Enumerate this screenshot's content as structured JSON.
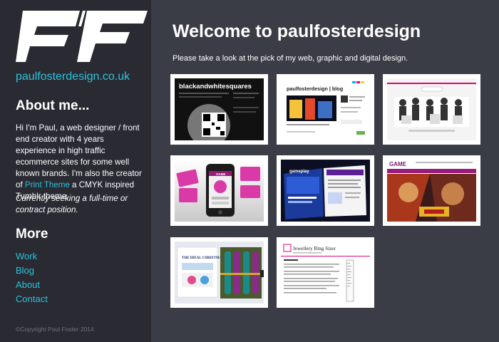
{
  "logo": {
    "text": "PF"
  },
  "sidebar": {
    "site_link": "paulfosterdesign.co.uk",
    "about_title": "About me...",
    "about_prefix": "Hi I'm Paul, a web designer / front end creator with 4 years experience in high traffic ecommerce sites for some well known brands. I'm also the creator of ",
    "print_theme_link": "Print Theme",
    "about_suffix": " a CMYK inspired Tumblr theme.",
    "seeking": "Currently seeking a full-time or contract position.",
    "more_title": "More",
    "nav": [
      "Work",
      "Blog",
      "About",
      "Contact"
    ],
    "copyright": "©Copyright Paul Foster 2014"
  },
  "main": {
    "title": "Welcome to paulfosterdesign",
    "intro": "Please take a look at the pick of my web, graphic and digital design."
  },
  "thumbs": [
    {
      "label": "blackandwhitesquares"
    },
    {
      "label": "paulfosterdesign | blog"
    },
    {
      "label": ""
    },
    {
      "label": "GAME"
    },
    {
      "label": "gameplay"
    },
    {
      "label": "GAME"
    },
    {
      "label": "THE IDEAL CHRISTMAS CRACKER"
    },
    {
      "label": "Jewellery Ring Sizer"
    }
  ],
  "colors": {
    "accent": "#2bc4dc",
    "sidebar_bg": "#292a32",
    "main_bg": "#3a3c46"
  }
}
